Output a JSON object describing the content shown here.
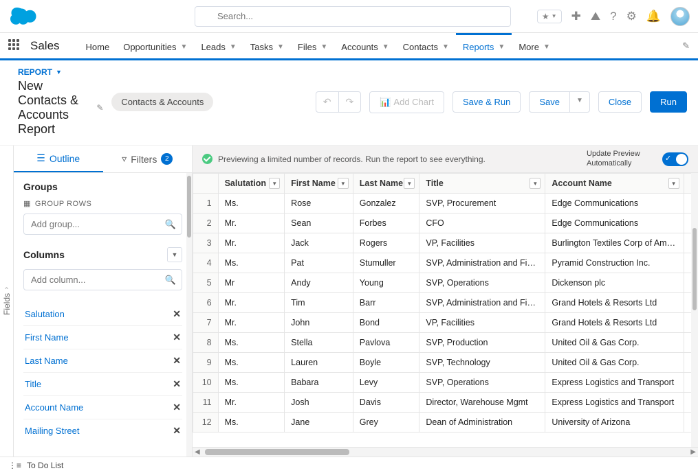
{
  "header": {
    "search_placeholder": "Search..."
  },
  "nav": {
    "app_name": "Sales",
    "items": [
      "Home",
      "Opportunities",
      "Leads",
      "Tasks",
      "Files",
      "Accounts",
      "Contacts",
      "Reports",
      "More"
    ],
    "active_index": 7
  },
  "report_header": {
    "type_label": "REPORT",
    "title": "New Contacts & Accounts Report",
    "pill": "Contacts & Accounts",
    "add_chart": "Add Chart",
    "save_run": "Save & Run",
    "save": "Save",
    "close": "Close",
    "run": "Run"
  },
  "sidebar": {
    "fields_tab": "Fields",
    "outline_tab": "Outline",
    "filters_tab": "Filters",
    "filter_count": "2",
    "groups_label": "Groups",
    "group_rows": "GROUP ROWS",
    "add_group_placeholder": "Add group...",
    "columns_label": "Columns",
    "add_column_placeholder": "Add column...",
    "columns": [
      "Salutation",
      "First Name",
      "Last Name",
      "Title",
      "Account Name",
      "Mailing Street"
    ]
  },
  "preview": {
    "text": "Previewing a limited number of records. Run the report to see everything.",
    "toggle_label": "Update Preview Automatically"
  },
  "table": {
    "headers": [
      "Salutation",
      "First Name",
      "Last Name",
      "Title",
      "Account Name"
    ],
    "rows": [
      {
        "n": "1",
        "sal": "Ms.",
        "fn": "Rose",
        "ln": "Gonzalez",
        "title": "SVP, Procurement",
        "acct": "Edge Communications"
      },
      {
        "n": "2",
        "sal": "Mr.",
        "fn": "Sean",
        "ln": "Forbes",
        "title": "CFO",
        "acct": "Edge Communications"
      },
      {
        "n": "3",
        "sal": "Mr.",
        "fn": "Jack",
        "ln": "Rogers",
        "title": "VP, Facilities",
        "acct": "Burlington Textiles Corp of America"
      },
      {
        "n": "4",
        "sal": "Ms.",
        "fn": "Pat",
        "ln": "Stumuller",
        "title": "SVP, Administration and Finance",
        "acct": "Pyramid Construction Inc."
      },
      {
        "n": "5",
        "sal": "Mr",
        "fn": "Andy",
        "ln": "Young",
        "title": "SVP, Operations",
        "acct": "Dickenson plc"
      },
      {
        "n": "6",
        "sal": "Mr.",
        "fn": "Tim",
        "ln": "Barr",
        "title": "SVP, Administration and Finance",
        "acct": "Grand Hotels & Resorts Ltd"
      },
      {
        "n": "7",
        "sal": "Mr.",
        "fn": "John",
        "ln": "Bond",
        "title": "VP, Facilities",
        "acct": "Grand Hotels & Resorts Ltd"
      },
      {
        "n": "8",
        "sal": "Ms.",
        "fn": "Stella",
        "ln": "Pavlova",
        "title": "SVP, Production",
        "acct": "United Oil & Gas Corp."
      },
      {
        "n": "9",
        "sal": "Ms.",
        "fn": "Lauren",
        "ln": "Boyle",
        "title": "SVP, Technology",
        "acct": "United Oil & Gas Corp."
      },
      {
        "n": "10",
        "sal": "Ms.",
        "fn": "Babara",
        "ln": "Levy",
        "title": "SVP, Operations",
        "acct": "Express Logistics and Transport"
      },
      {
        "n": "11",
        "sal": "Mr.",
        "fn": "Josh",
        "ln": "Davis",
        "title": "Director, Warehouse Mgmt",
        "acct": "Express Logistics and Transport"
      },
      {
        "n": "12",
        "sal": "Ms.",
        "fn": "Jane",
        "ln": "Grey",
        "title": "Dean of Administration",
        "acct": "University of Arizona"
      }
    ]
  },
  "footer": {
    "todo": "To Do List"
  }
}
